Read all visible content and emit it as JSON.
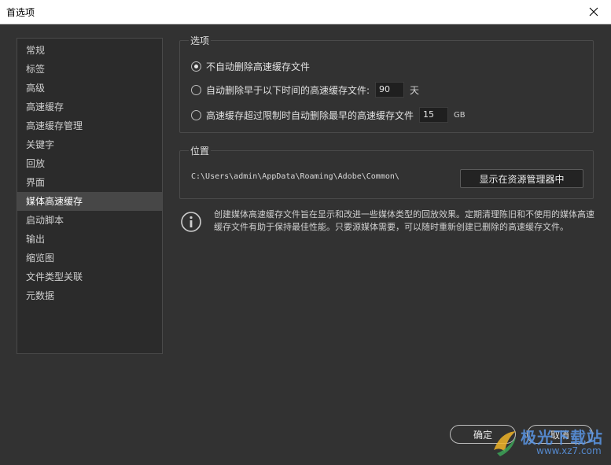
{
  "window": {
    "title": "首选项"
  },
  "sidebar": {
    "items": [
      {
        "label": "常规"
      },
      {
        "label": "标签"
      },
      {
        "label": "高级"
      },
      {
        "label": "高速缓存"
      },
      {
        "label": "高速缓存管理"
      },
      {
        "label": "关键字"
      },
      {
        "label": "回放"
      },
      {
        "label": "界面"
      },
      {
        "label": "媒体高速缓存",
        "selected": true
      },
      {
        "label": "启动脚本"
      },
      {
        "label": "输出"
      },
      {
        "label": "缩览图"
      },
      {
        "label": "文件类型关联"
      },
      {
        "label": "元数据"
      }
    ]
  },
  "options": {
    "group_label": "选项",
    "opt1": {
      "label": "不自动删除高速缓存文件",
      "checked": true
    },
    "opt2": {
      "label": "自动删除早于以下时间的高速缓存文件:",
      "value": "90",
      "unit": "天",
      "checked": false
    },
    "opt3": {
      "label": "高速缓存超过限制时自动删除最早的高速缓存文件",
      "value": "15",
      "unit": "GB",
      "checked": false
    }
  },
  "location": {
    "group_label": "位置",
    "path": "C:\\Users\\admin\\AppData\\Roaming\\Adobe\\Common\\",
    "show_button": "显示在资源管理器中"
  },
  "info": {
    "icon": "info-icon",
    "text": "创建媒体高速缓存文件旨在显示和改进一些媒体类型的回放效果。定期清理陈旧和不使用的媒体高速缓存文件有助于保持最佳性能。只要源媒体需要，可以随时重新创建已删除的高速缓存文件。"
  },
  "footer": {
    "ok_label": "确定",
    "cancel_label": "取消"
  },
  "watermark": {
    "text": "极光下载站",
    "url": "www.xz7.com"
  },
  "colors": {
    "background": "#323232",
    "sidebar_bg": "#2b2b2b",
    "selected_bg": "#474747",
    "titlebar_bg": "#ffffff"
  }
}
